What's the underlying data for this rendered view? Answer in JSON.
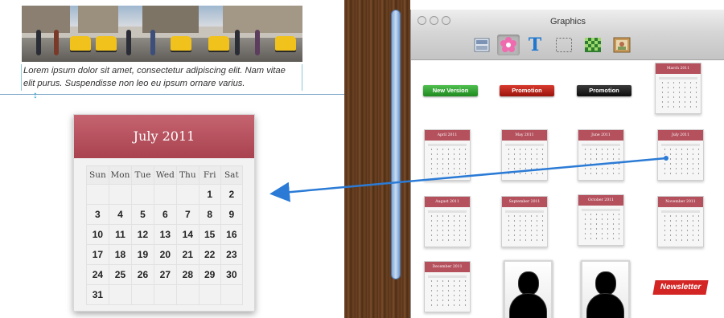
{
  "document": {
    "paragraph_line1": "Lorem ipsum dolor sit amet, consectetur adipiscing elit. Nam vitae",
    "paragraph_line2": "elit purus. Suspendisse non leo eu ipsum ornare varius."
  },
  "calendar": {
    "title": "July 2011",
    "weekdays": [
      "Sun",
      "Mon",
      "Tue",
      "Wed",
      "Thu",
      "Fri",
      "Sat"
    ],
    "weeks": [
      [
        "",
        "",
        "",
        "",
        "",
        "1",
        "2"
      ],
      [
        "3",
        "4",
        "5",
        "6",
        "7",
        "8",
        "9"
      ],
      [
        "10",
        "11",
        "12",
        "13",
        "14",
        "15",
        "16"
      ],
      [
        "17",
        "18",
        "19",
        "20",
        "21",
        "22",
        "23"
      ],
      [
        "24",
        "25",
        "26",
        "27",
        "28",
        "29",
        "30"
      ],
      [
        "31",
        "",
        "",
        "",
        "",
        "",
        ""
      ]
    ],
    "header_color": "#b04c59"
  },
  "window": {
    "title": "Graphics",
    "toolbar_icons": [
      "layout-icon",
      "flower-icon",
      "text-t-icon",
      "selection-rectangle-icon",
      "checker-pattern-icon",
      "picture-frame-icon"
    ],
    "selected_tool": "flower-icon"
  },
  "palette": {
    "buttons": [
      {
        "label": "New Version",
        "color": "#2e9a2e"
      },
      {
        "label": "Promotion",
        "color": "#b81b12"
      },
      {
        "label": "Promotion",
        "color": "#161616"
      }
    ],
    "calendars": [
      "March 2011",
      "April 2011",
      "May 2011",
      "June 2011",
      "July 2011",
      "August 2011",
      "September 2011",
      "October 2011",
      "November 2011",
      "December 2011"
    ],
    "newsletter_label": "Newsletter"
  }
}
